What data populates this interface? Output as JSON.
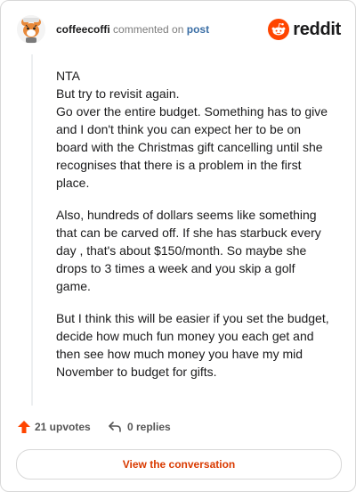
{
  "header": {
    "author": "coffeecoffi",
    "commented_text": "commented on",
    "post_link": "post",
    "brand": "reddit"
  },
  "comment": {
    "paragraphs": [
      [
        "NTA",
        "But try to revisit again.",
        "Go over the entire budget. Something has to give",
        "and I don't think you can expect her to be on",
        "board with the Christmas gift cancelling until she",
        "recognises that there is a problem in the first",
        "place."
      ],
      [
        "Also, hundreds of dollars seems like something",
        "that can be carved off. If she has starbuck every",
        "day , that's about $150/month. So maybe she",
        "drops to 3 times a week and you skip a golf",
        "game."
      ],
      [
        "But I think this will be easier if you set the budget,",
        "decide how much fun money you each get and",
        "then see how much money you have my mid",
        "November to budget for gifts."
      ]
    ]
  },
  "footer": {
    "upvotes": "21 upvotes",
    "replies": "0 replies"
  },
  "cta": {
    "label": "View the conversation"
  },
  "colors": {
    "brand": "#ff4500",
    "upvote": "#ff4500",
    "cta_text": "#d93a00",
    "link": "#3a6ea5"
  },
  "icons": {
    "avatar": "tiger-avatar",
    "brand": "reddit-snoo-icon",
    "upvote": "upvote-arrow-icon",
    "reply": "reply-arrow-icon"
  }
}
